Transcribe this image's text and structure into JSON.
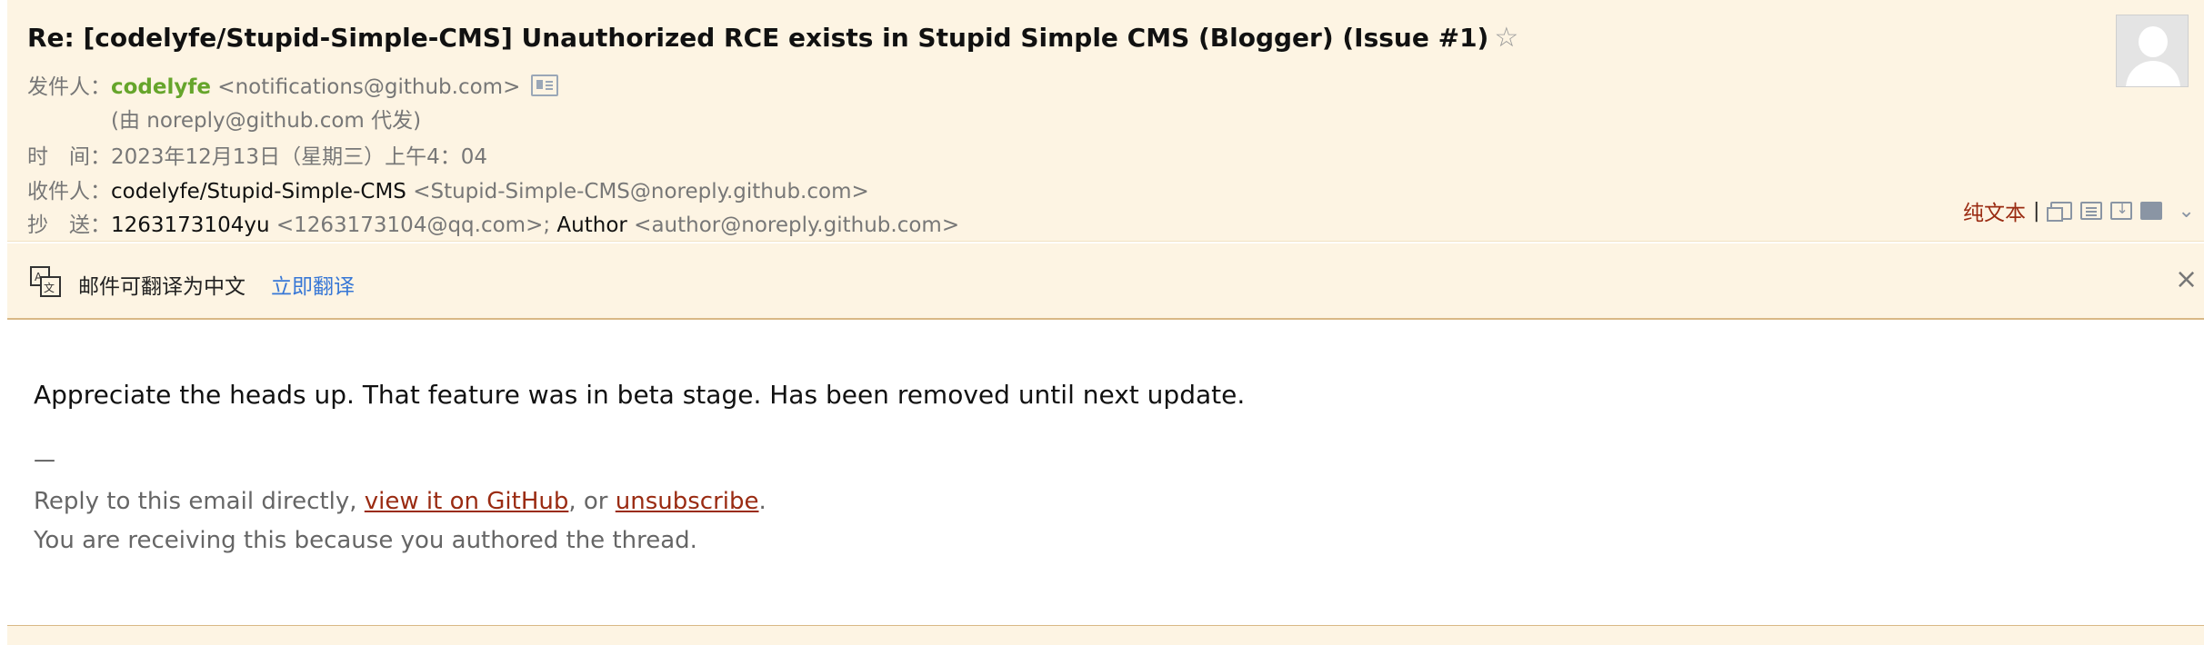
{
  "header": {
    "subject": "Re: [codelyfe/Stupid-Simple-CMS] Unauthorized RCE exists in Stupid Simple CMS (Blogger) (Issue #1)",
    "star_icon": "star-icon",
    "from_label": "发件人：",
    "sender_name": "codelyfe",
    "sender_email": "<notifications@github.com>",
    "proxy_line": "(由 noreply@github.com 代发)",
    "time_label": "时　间：",
    "time_value": "2023年12月13日（星期三）上午4：04",
    "to_label": "收件人：",
    "to_name": "codelyfe/Stupid-Simple-CMS",
    "to_email": "<Stupid-Simple-CMS@noreply.github.com>",
    "cc_label": "抄　送：",
    "cc_name1": "1263173104yu",
    "cc_email1": "<1263173104@qq.com>;",
    "cc_name2": "Author",
    "cc_email2": "<author@noreply.github.com>"
  },
  "toolbar": {
    "plain_text_label": "纯文本",
    "separator": "|",
    "icons": [
      "new-window-icon",
      "view-source-icon",
      "download-icon",
      "print-icon",
      "chevron-down-icon"
    ]
  },
  "translate_bar": {
    "message": "邮件可翻译为中文",
    "action": "立即翻译",
    "close": "×"
  },
  "body": {
    "text": "Appreciate the heads up. That feature was in beta stage. Has been removed until next update.",
    "dash": "—",
    "footer_prefix": "Reply to this email directly, ",
    "link_view": "view it on GitHub",
    "footer_mid": ", or ",
    "link_unsub": "unsubscribe",
    "footer_end": ".",
    "footer_line2": "You are receiving this because you authored the thread."
  }
}
